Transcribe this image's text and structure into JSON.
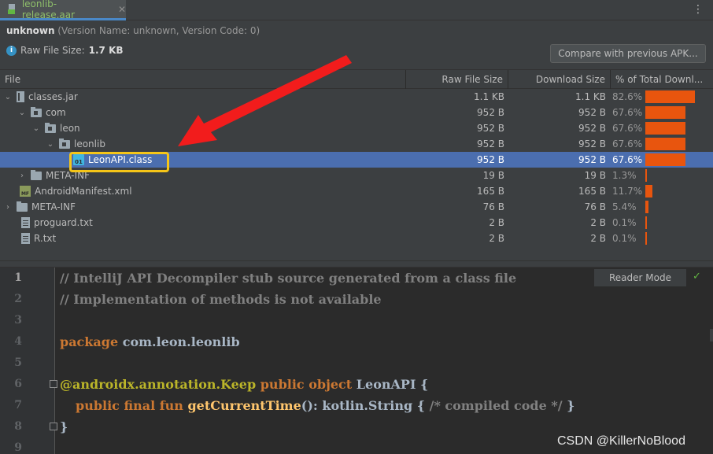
{
  "tab": {
    "label": "leonlib-release.aar",
    "close": "✕"
  },
  "menu_icon": "⋮",
  "info": {
    "app_name": "unknown",
    "app_meta": " (Version Name: unknown, Version Code: 0)",
    "raw_label": "Raw File Size:",
    "raw_value": "1.7 KB",
    "compare_button": "Compare with previous APK..."
  },
  "columns": {
    "file": "File",
    "raw": "Raw File Size",
    "download": "Download Size",
    "pct": "% of Total Downl..."
  },
  "rows": [
    {
      "name": "classes.jar",
      "raw": "1.1 KB",
      "dl": "1.1 KB",
      "pct": "82.6%",
      "pct_value": 82.6,
      "icon": "jar-icon",
      "chevron": "⌄"
    },
    {
      "name": "com",
      "raw": "952 B",
      "dl": "952 B",
      "pct": "67.6%",
      "pct_value": 67.6,
      "icon": "package-icon",
      "chevron": "⌄"
    },
    {
      "name": "leon",
      "raw": "952 B",
      "dl": "952 B",
      "pct": "67.6%",
      "pct_value": 67.6,
      "icon": "package-icon",
      "chevron": "⌄"
    },
    {
      "name": "leonlib",
      "raw": "952 B",
      "dl": "952 B",
      "pct": "67.6%",
      "pct_value": 67.6,
      "icon": "package-icon",
      "chevron": "⌄"
    },
    {
      "name": "LeonAPI.class",
      "raw": "952 B",
      "dl": "952 B",
      "pct": "67.6%",
      "pct_value": 67.6,
      "icon": "class-icon",
      "icon_text": "01"
    },
    {
      "name": "META-INF",
      "raw": "19 B",
      "dl": "19 B",
      "pct": "1.3%",
      "pct_value": 1.3,
      "icon": "folder-icon",
      "chevron": "›"
    },
    {
      "name": "AndroidManifest.xml",
      "raw": "165 B",
      "dl": "165 B",
      "pct": "11.7%",
      "pct_value": 11.7,
      "icon": "manifest-icon",
      "icon_text": "MF"
    },
    {
      "name": "META-INF",
      "raw": "76 B",
      "dl": "76 B",
      "pct": "5.4%",
      "pct_value": 5.4,
      "icon": "folder-icon",
      "chevron": "›"
    },
    {
      "name": "proguard.txt",
      "raw": "2 B",
      "dl": "2 B",
      "pct": "0.1%",
      "pct_value": 0.1,
      "icon": "text-file-icon"
    },
    {
      "name": "R.txt",
      "raw": "2 B",
      "dl": "2 B",
      "pct": "0.1%",
      "pct_value": 0.1,
      "icon": "text-file-icon"
    }
  ],
  "selected_row": 4,
  "editor": {
    "line_numbers": [
      "1",
      "2",
      "3",
      "4",
      "5",
      "6",
      "7",
      "8",
      "9"
    ],
    "line1": "// IntelliJ API Decompiler stub source generated from a class file",
    "line2": "// Implementation of methods is not available",
    "line4_kw": "package",
    "line4_txt": " com.leon.leonlib",
    "line6_ann": "@androidx.annotation.Keep",
    "line6_kw": " public object",
    "line6_txt": " LeonAPI {",
    "line7_kw": "public final fun",
    "line7_fn": "getCurrentTime",
    "line7_txt": "(): kotlin.String { ",
    "line7_comment": "/* compiled code */",
    "line7_end": " }",
    "line8": "}",
    "reader_mode": "Reader Mode",
    "check": "✓"
  },
  "watermark": "CSDN @KillerNoBlood",
  "colors": {
    "selection": "#4b6eaf",
    "bar": "#e8550e",
    "highlight": "#f5c518",
    "arrow": "#f21c1c"
  }
}
